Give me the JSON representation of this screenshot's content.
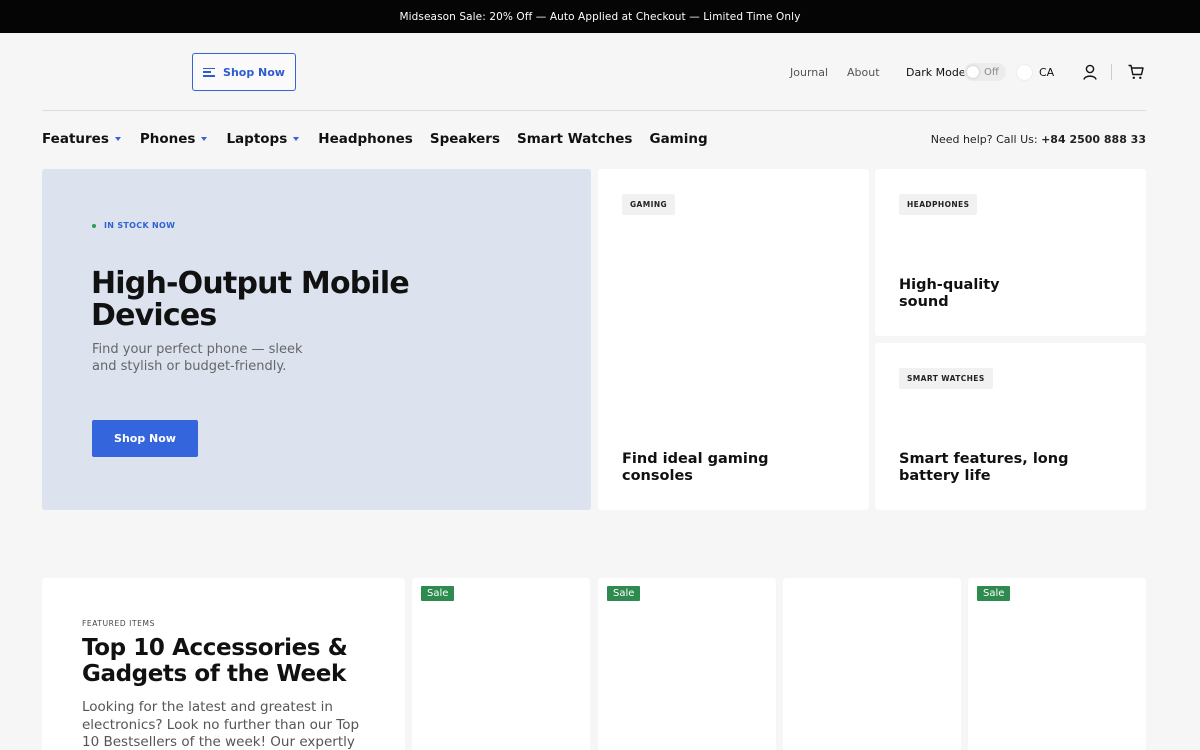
{
  "announcement": "Midseason Sale: 20% Off — Auto Applied at Checkout — Limited Time Only",
  "header": {
    "shop_now": "Shop Now",
    "links": [
      "Journal",
      "About"
    ],
    "dark_mode_label": "Dark Mode",
    "dark_mode_state": "Off",
    "region": "CA"
  },
  "nav": {
    "items": [
      "Features",
      "Phones",
      "Laptops",
      "Headphones",
      "Speakers",
      "Smart Watches",
      "Gaming"
    ],
    "help_text": "Need help? Call Us:",
    "help_phone": "+84 2500 888 33"
  },
  "hero": {
    "badge": "IN STOCK NOW",
    "title": "High-Output Mobile Devices",
    "subtitle": "Find your perfect phone — sleek and stylish or budget-friendly.",
    "button": "Shop Now"
  },
  "cards": [
    {
      "tag": "GAMING",
      "title": "Find ideal gaming consoles"
    },
    {
      "tag": "HEADPHONES",
      "title": "High-quality sound"
    },
    {
      "tag": "SMART WATCHES",
      "title": "Smart features, long battery life"
    }
  ],
  "featured": {
    "label": "FEATURED ITEMS",
    "title": "Top 10 Accessories & Gadgets of the Week",
    "description": "Looking for the latest and greatest in electronics? Look no further than our Top 10 Bestsellers of the week! Our expertly curated"
  },
  "products": [
    {
      "badge": "Sale"
    },
    {
      "badge": "Sale"
    },
    {
      "badge": ""
    },
    {
      "badge": "Sale"
    }
  ],
  "colors": {
    "accent": "#3565dc",
    "hero_bg": "#dce3ef",
    "sale_badge": "#2e8a4e",
    "announcement_bg": "#050505"
  }
}
